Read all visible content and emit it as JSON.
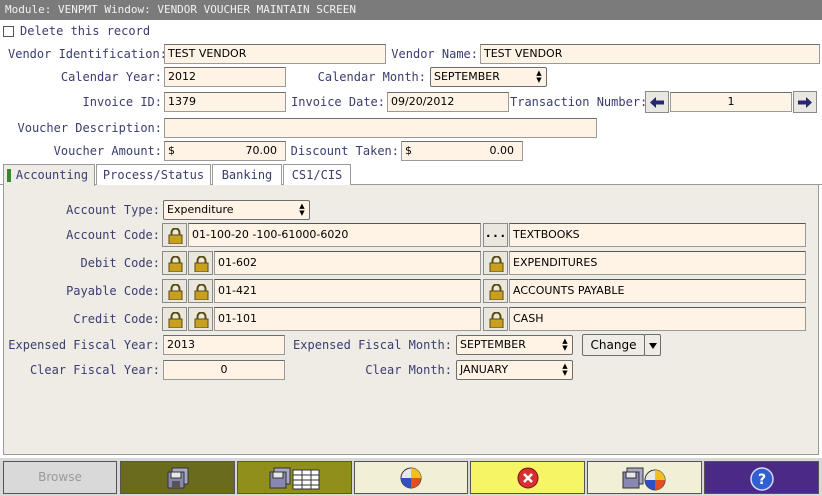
{
  "window": {
    "title": "Module: VENPMT Window: VENDOR VOUCHER MAINTAIN SCREEN"
  },
  "delete": {
    "label": "Delete this record",
    "checked": false
  },
  "header": {
    "vendor_id_label": "Vendor Identification:",
    "vendor_id": "TEST VENDOR",
    "vendor_name_label": "Vendor Name:",
    "vendor_name": "TEST VENDOR",
    "calendar_year_label": "Calendar Year:",
    "calendar_year": "2012",
    "calendar_month_label": "Calendar Month:",
    "calendar_month": "SEPTEMBER",
    "invoice_id_label": "Invoice ID:",
    "invoice_id": "1379",
    "invoice_date_label": "Invoice Date:",
    "invoice_date": "09/20/2012",
    "transaction_number_label": "Transaction Number:",
    "transaction_number": "1",
    "voucher_description_label": "Voucher Description:",
    "voucher_description": "",
    "voucher_amount_label": "Voucher Amount:",
    "voucher_amount_currency": "$",
    "voucher_amount": "70.00",
    "discount_taken_label": "Discount Taken:",
    "discount_taken_currency": "$",
    "discount_taken": "0.00"
  },
  "tabs": [
    {
      "label": "Accounting",
      "active": true
    },
    {
      "label": "Process/Status",
      "active": false
    },
    {
      "label": "Banking",
      "active": false
    },
    {
      "label": "CS1/CIS",
      "active": false
    }
  ],
  "accounting": {
    "account_type_label": "Account Type:",
    "account_type": "Expenditure",
    "account_code_label": "Account Code:",
    "account_code": "01-100-20 -100-61000-6020",
    "account_code_more": "...",
    "account_code_desc": "TEXTBOOKS",
    "debit_code_label": "Debit Code:",
    "debit_code": "01-602",
    "debit_code_desc": "EXPENDITURES",
    "payable_code_label": "Payable Code:",
    "payable_code": "01-421",
    "payable_code_desc": "ACCOUNTS PAYABLE",
    "credit_code_label": "Credit Code:",
    "credit_code": "01-101",
    "credit_code_desc": "CASH",
    "expensed_fiscal_year_label": "Expensed Fiscal Year:",
    "expensed_fiscal_year": "2013",
    "expensed_fiscal_month_label": "Expensed Fiscal Month:",
    "expensed_fiscal_month": "SEPTEMBER",
    "change_label": "Change",
    "clear_fiscal_year_label": "Clear Fiscal Year:",
    "clear_fiscal_year": "0",
    "clear_month_label": "Clear Month:",
    "clear_month": "JANUARY"
  },
  "toolbar": {
    "browse_label": "Browse",
    "buttons": [
      {
        "name": "browse",
        "color": "#d9d9d9"
      },
      {
        "name": "save-record",
        "color": "#6b6b1e",
        "icon": "floppy-icon"
      },
      {
        "name": "save-multiple",
        "color": "#8f8f1a",
        "icon": "floppy-grid-icon"
      },
      {
        "name": "clear",
        "color": "#f1efd6",
        "icon": "color-wheel-icon"
      },
      {
        "name": "cancel",
        "color": "#f5f565",
        "icon": "cancel-icon"
      },
      {
        "name": "save-clear",
        "color": "#f1efd6",
        "icon": "floppy-wheel-icon"
      },
      {
        "name": "help",
        "color": "#4b2a86",
        "icon": "help-icon"
      }
    ]
  }
}
